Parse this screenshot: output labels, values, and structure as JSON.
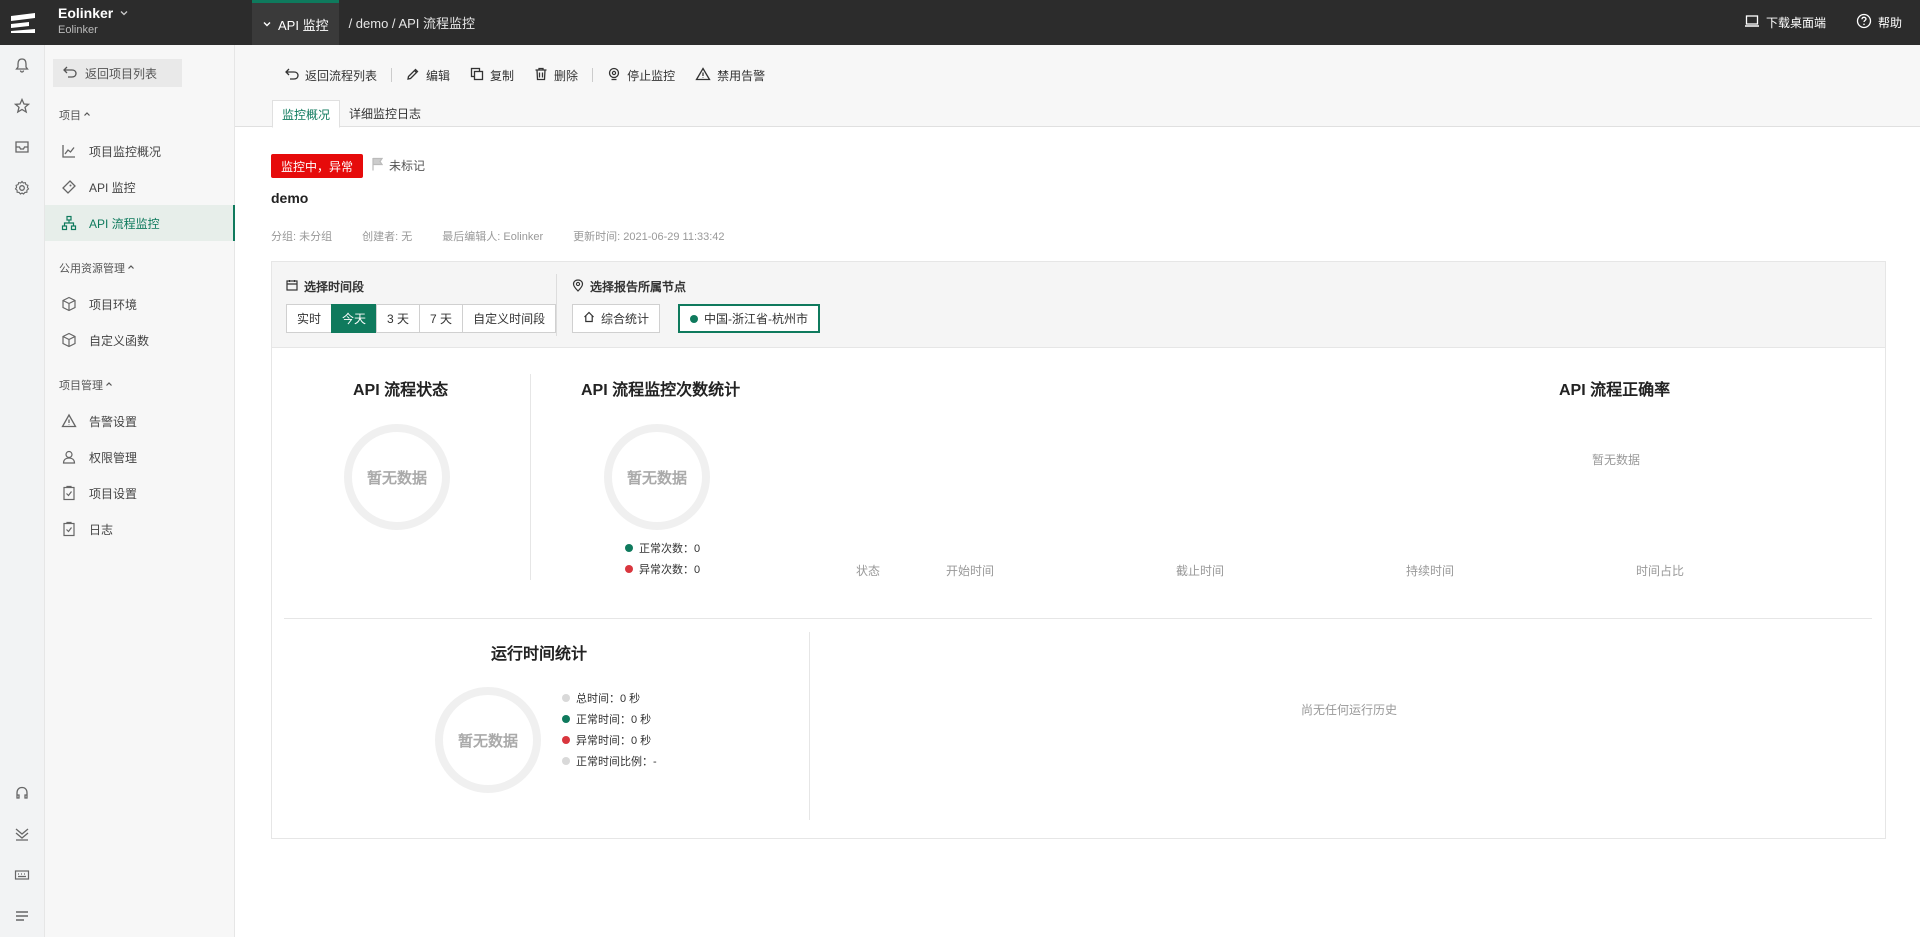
{
  "app": {
    "org_name": "Eolinker",
    "org_sub": "Eolinker"
  },
  "breadcrumb": {
    "active": "API 监控",
    "rest": "/ demo / API 流程监控"
  },
  "top_right": {
    "download": "下载桌面端",
    "help": "帮助"
  },
  "sidebar": {
    "back": "返回项目列表",
    "groups": [
      {
        "title": "项目",
        "items": [
          "项目监控概况",
          "API 监控",
          "API 流程监控"
        ]
      },
      {
        "title": "公用资源管理",
        "items": [
          "项目环境",
          "自定义函数"
        ]
      },
      {
        "title": "项目管理",
        "items": [
          "告警设置",
          "权限管理",
          "项目设置",
          "日志"
        ]
      }
    ]
  },
  "toolbar": {
    "back": "返回流程列表",
    "edit": "编辑",
    "copy": "复制",
    "delete": "删除",
    "stop": "停止监控",
    "disable_alert": "禁用告警"
  },
  "tabs": [
    "监控概况",
    "详细监控日志"
  ],
  "status": {
    "badge": "监控中，异常",
    "flag": "未标记",
    "title": "demo",
    "meta": [
      "分组: 未分组",
      "创建者: 无",
      "最后编辑人: Eolinker",
      "更新时间:  2021-06-29 11:33:42"
    ]
  },
  "filter": {
    "time_label": "选择时间段",
    "time_options": [
      "实时",
      "今天",
      "3 天",
      "7 天",
      "自定义时间段"
    ],
    "time_selected": "今天",
    "node_label": "选择报告所属节点",
    "nodes": [
      "综合统计",
      "中国-浙江省-杭州市"
    ],
    "node_selected": "中国-浙江省-杭州市"
  },
  "sections": {
    "api_status": {
      "title": "API 流程状态",
      "empty": "暂无数据"
    },
    "count_stats": {
      "title": "API 流程监控次数统计",
      "empty": "暂无数据",
      "legend": [
        "正常次数：0",
        "异常次数：0"
      ]
    },
    "accuracy": {
      "title": "API 流程正确率",
      "empty": "暂无数据"
    },
    "runtime": {
      "title": "运行时间统计",
      "empty": "暂无数据",
      "legend": [
        "总时间：0 秒",
        "正常时间：0 秒",
        "异常时间：0 秒",
        "正常时间比例：-"
      ]
    },
    "history": {
      "columns": [
        "状态",
        "开始时间",
        "截止时间",
        "持续时间",
        "时间占比"
      ],
      "empty": "尚无任何运行历史"
    }
  },
  "colors": {
    "accent": "#0f7a5d",
    "danger": "#e60b0b",
    "error_dot": "#d9363e",
    "neutral_dot": "#d9d9d9"
  }
}
